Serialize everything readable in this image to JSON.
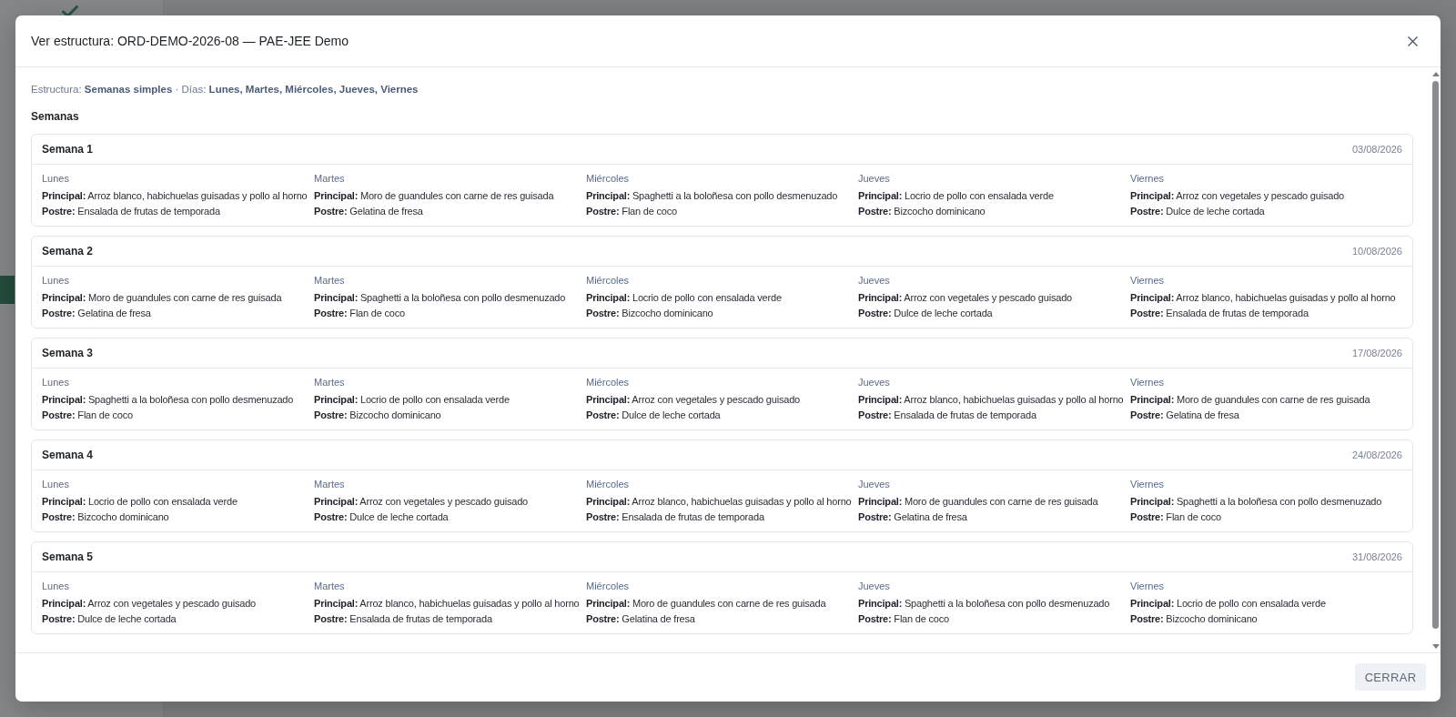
{
  "modal": {
    "title": "Ver estructura: ORD-DEMO-2026-08 — PAE-JEE Demo",
    "summary": "Estructura: **Semanas simples** · Días: **Lunes, Martes, Miércoles, Jueves, Viernes**",
    "section_title": "Semanas",
    "weeks": [
      {
        "title": "Semana 1",
        "date": "03/08/2026",
        "days": [
          {
            "day": "Lunes",
            "main": "**Principal:** Arroz blanco, habichuelas guisadas y pollo al horno",
            "dessert": "**Postre:** Ensalada de frutas de temporada"
          },
          {
            "day": "Martes",
            "main": "**Principal:** Moro de guandules con carne de res guisada",
            "dessert": "**Postre:** Gelatina de fresa"
          },
          {
            "day": "Miércoles",
            "main": "**Principal:** Spaghetti a la boloñesa con pollo desmenuzado",
            "dessert": "**Postre:** Flan de coco"
          },
          {
            "day": "Jueves",
            "main": "**Principal:** Locrio de pollo con ensalada verde",
            "dessert": "**Postre:** Bizcocho dominicano"
          },
          {
            "day": "Viernes",
            "main": "**Principal:** Arroz con vegetales y pescado guisado",
            "dessert": "**Postre:** Dulce de leche cortada"
          }
        ]
      },
      {
        "title": "Semana 2",
        "date": "10/08/2026",
        "days": [
          {
            "day": "Lunes",
            "main": "**Principal:** Moro de guandules con carne de res guisada",
            "dessert": "**Postre:** Gelatina de fresa"
          },
          {
            "day": "Martes",
            "main": "**Principal:** Spaghetti a la boloñesa con pollo desmenuzado",
            "dessert": "**Postre:** Flan de coco"
          },
          {
            "day": "Miércoles",
            "main": "**Principal:** Locrio de pollo con ensalada verde",
            "dessert": "**Postre:** Bizcocho dominicano"
          },
          {
            "day": "Jueves",
            "main": "**Principal:** Arroz con vegetales y pescado guisado",
            "dessert": "**Postre:** Dulce de leche cortada"
          },
          {
            "day": "Viernes",
            "main": "**Principal:** Arroz blanco, habichuelas guisadas y pollo al horno",
            "dessert": "**Postre:** Ensalada de frutas de temporada"
          }
        ]
      },
      {
        "title": "Semana 3",
        "date": "17/08/2026",
        "days": [
          {
            "day": "Lunes",
            "main": "**Principal:** Spaghetti a la boloñesa con pollo desmenuzado",
            "dessert": "**Postre:** Flan de coco"
          },
          {
            "day": "Martes",
            "main": "**Principal:** Locrio de pollo con ensalada verde",
            "dessert": "**Postre:** Bizcocho dominicano"
          },
          {
            "day": "Miércoles",
            "main": "**Principal:** Arroz con vegetales y pescado guisado",
            "dessert": "**Postre:** Dulce de leche cortada"
          },
          {
            "day": "Jueves",
            "main": "**Principal:** Arroz blanco, habichuelas guisadas y pollo al horno",
            "dessert": "**Postre:** Ensalada de frutas de temporada"
          },
          {
            "day": "Viernes",
            "main": "**Principal:** Moro de guandules con carne de res guisada",
            "dessert": "**Postre:** Gelatina de fresa"
          }
        ]
      },
      {
        "title": "Semana 4",
        "date": "24/08/2026",
        "days": [
          {
            "day": "Lunes",
            "main": "**Principal:** Locrio de pollo con ensalada verde",
            "dessert": "**Postre:** Bizcocho dominicano"
          },
          {
            "day": "Martes",
            "main": "**Principal:** Arroz con vegetales y pescado guisado",
            "dessert": "**Postre:** Dulce de leche cortada"
          },
          {
            "day": "Miércoles",
            "main": "**Principal:** Arroz blanco, habichuelas guisadas y pollo al horno",
            "dessert": "**Postre:** Ensalada de frutas de temporada"
          },
          {
            "day": "Jueves",
            "main": "**Principal:** Moro de guandules con carne de res guisada",
            "dessert": "**Postre:** Gelatina de fresa"
          },
          {
            "day": "Viernes",
            "main": "**Principal:** Spaghetti a la boloñesa con pollo desmenuzado",
            "dessert": "**Postre:** Flan de coco"
          }
        ]
      },
      {
        "title": "Semana 5",
        "date": "31/08/2026",
        "days": [
          {
            "day": "Lunes",
            "main": "**Principal:** Arroz con vegetales y pescado guisado",
            "dessert": "**Postre:** Dulce de leche cortada"
          },
          {
            "day": "Martes",
            "main": "**Principal:** Arroz blanco, habichuelas guisadas y pollo al horno",
            "dessert": "**Postre:** Ensalada de frutas de temporada"
          },
          {
            "day": "Miércoles",
            "main": "**Principal:** Moro de guandules con carne de res guisada",
            "dessert": "**Postre:** Gelatina de fresa"
          },
          {
            "day": "Jueves",
            "main": "**Principal:** Spaghetti a la boloñesa con pollo desmenuzado",
            "dessert": "**Postre:** Flan de coco"
          },
          {
            "day": "Viernes",
            "main": "**Principal:** Locrio de pollo con ensalada verde",
            "dessert": "**Postre:** Bizcocho dominicano"
          }
        ]
      }
    ],
    "footer_button": "CERRAR"
  }
}
